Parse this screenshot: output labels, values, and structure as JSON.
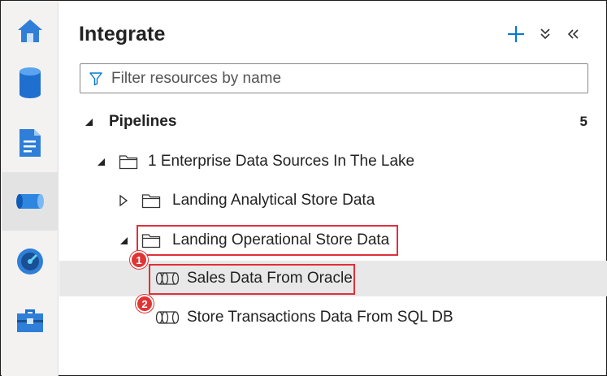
{
  "panel": {
    "title": "Integrate"
  },
  "toolbar": {
    "add_icon": "plus-icon",
    "expand_icon": "double-chevron-down-icon",
    "collapse_icon": "double-chevron-left-icon"
  },
  "filter": {
    "placeholder": "Filter resources by name",
    "value": ""
  },
  "nav": [
    {
      "name": "home",
      "icon": "home-icon"
    },
    {
      "name": "data",
      "icon": "database-icon"
    },
    {
      "name": "develop",
      "icon": "document-icon"
    },
    {
      "name": "integrate",
      "icon": "pipeline-icon",
      "active": true
    },
    {
      "name": "monitor",
      "icon": "gauge-icon"
    },
    {
      "name": "manage",
      "icon": "toolbox-icon"
    }
  ],
  "tree": {
    "pipelines_label": "Pipelines",
    "pipelines_count": "5",
    "folder_enterprise": "1 Enterprise Data Sources In The Lake",
    "folder_analytical": "Landing Analytical Store Data",
    "folder_operational": "Landing Operational Store Data",
    "pipeline_oracle": "Sales Data From Oracle",
    "pipeline_sql": "Store Transactions Data From SQL DB"
  },
  "callouts": {
    "step1": "1",
    "step2": "2"
  },
  "colors": {
    "accent": "#0078d4",
    "callout": "#e0303a",
    "selected_row": "#e8e8e8"
  }
}
